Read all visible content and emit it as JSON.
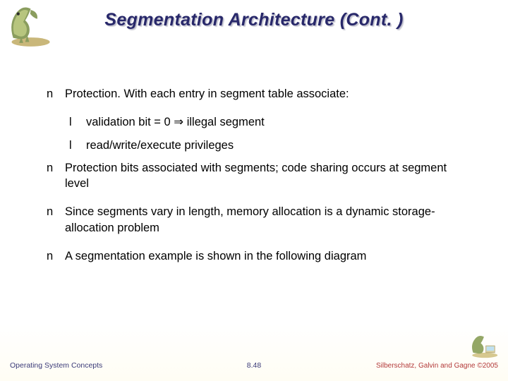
{
  "title": "Segmentation Architecture (Cont. )",
  "bullets": {
    "b0": "Protection.  With each entry in segment table associate:",
    "b0a": "validation bit = 0 ⇒ illegal segment",
    "b0b": "read/write/execute privileges",
    "b1": "Protection bits associated with segments; code sharing occurs at segment level",
    "b2": "Since segments vary in length, memory allocation is a dynamic storage-allocation problem",
    "b3": "A segmentation example is shown in the following diagram"
  },
  "markers": {
    "l1": "n",
    "l2": "l"
  },
  "footer": {
    "left": "Operating System Concepts",
    "center": "8.48",
    "right": "Silberschatz, Galvin and Gagne ©2005"
  }
}
